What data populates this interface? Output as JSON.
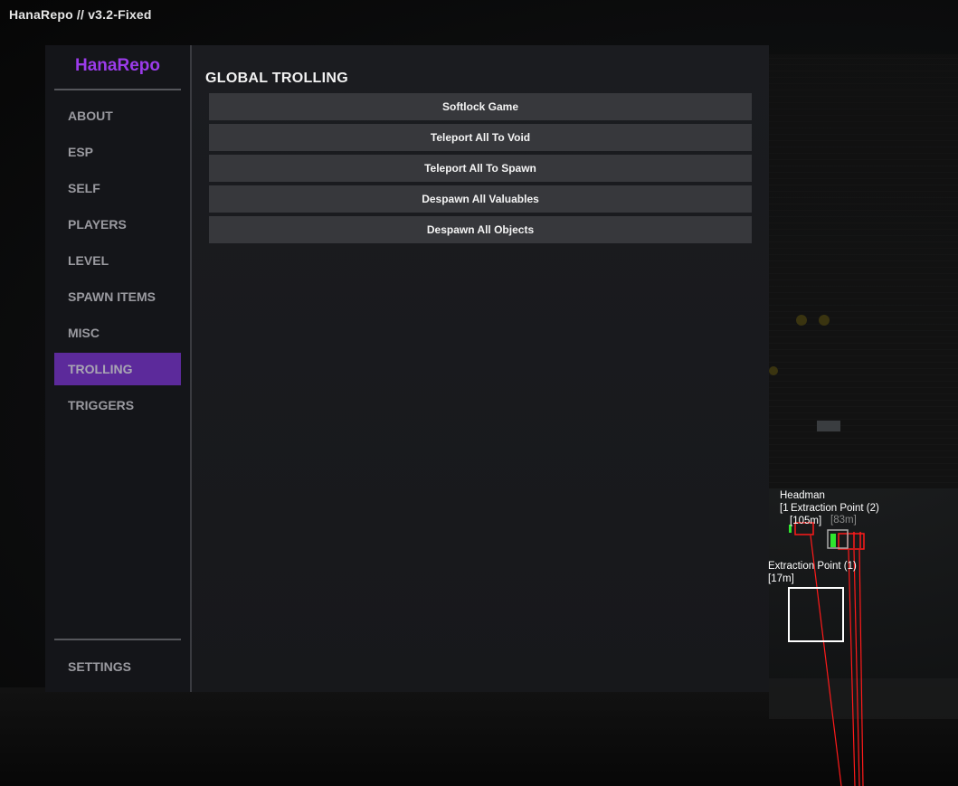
{
  "watermark": "HanaRepo // v3.2-Fixed",
  "sidebar": {
    "brand": "HanaRepo",
    "items": [
      {
        "label": "ABOUT"
      },
      {
        "label": "ESP"
      },
      {
        "label": "SELF"
      },
      {
        "label": "PLAYERS"
      },
      {
        "label": "LEVEL"
      },
      {
        "label": "SPAWN ITEMS"
      },
      {
        "label": "MISC"
      },
      {
        "label": "TROLLING",
        "active": true
      },
      {
        "label": "TRIGGERS"
      }
    ],
    "settings_label": "SETTINGS"
  },
  "content": {
    "title": "GLOBAL TROLLING",
    "actions": [
      {
        "label": "Softlock Game"
      },
      {
        "label": "Teleport All To Void"
      },
      {
        "label": "Teleport All To Spawn"
      },
      {
        "label": "Despawn All Valuables"
      },
      {
        "label": "Despawn All Objects"
      }
    ]
  },
  "esp": {
    "headman": {
      "name": "Headman",
      "prefix": "[1",
      "distance": "[105m]"
    },
    "extraction_2": {
      "name": "Extraction Point (2)",
      "distance": "[83m]"
    },
    "extraction_1": {
      "name": "Extraction Point (1)",
      "distance": "[17m]"
    }
  },
  "colors": {
    "accent": "#9b3bea",
    "active_tab": "#5c2a9b",
    "button_bg": "#37383c",
    "esp_line": "#ff1a1a"
  }
}
